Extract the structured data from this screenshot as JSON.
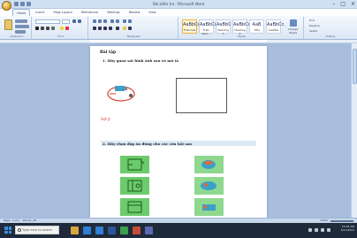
{
  "window": {
    "title": "Bài kiểm tra - Microsoft Word"
  },
  "ribbon": {
    "tabs": [
      "Home",
      "Insert",
      "Page Layout",
      "References",
      "Mailings",
      "Review",
      "View"
    ],
    "active_tab": "Home",
    "groups": [
      "Clipboard",
      "Font",
      "Paragraph",
      "Styles",
      "Editing"
    ],
    "styles": [
      {
        "preview": "AaBbCcDc",
        "name": "¶ Normal"
      },
      {
        "preview": "AaBbCcDc",
        "name": "¶ No Spac..."
      },
      {
        "preview": "AaBbC",
        "name": "Heading 1"
      },
      {
        "preview": "AaBbCc",
        "name": "Heading 2"
      },
      {
        "preview": "AaB",
        "name": "Title"
      },
      {
        "preview": "AaBbCc.",
        "name": "Subtitle"
      }
    ],
    "change_styles": "Change Styles",
    "editing": [
      "Find",
      "Replace",
      "Select"
    ]
  },
  "document": {
    "heading": "Bài tập",
    "q1": "1. Hãy quan sát hình ảnh sau và mô tả",
    "guide": "Gợi ý:",
    "q2": "2. Hãy chọn đáp án đúng cho các câu hỏi sau"
  },
  "statusbar": {
    "page": "Page: 1 of 2",
    "words": "Words: 28",
    "zoom": "100%"
  },
  "taskbar": {
    "search_placeholder": "Type here to search",
    "time": "10:25 AM",
    "date": "5/17/2021"
  },
  "colors": {
    "accent": "#2b579a",
    "green": "#6ccb6c",
    "taskbar": "#1f2a3a"
  }
}
